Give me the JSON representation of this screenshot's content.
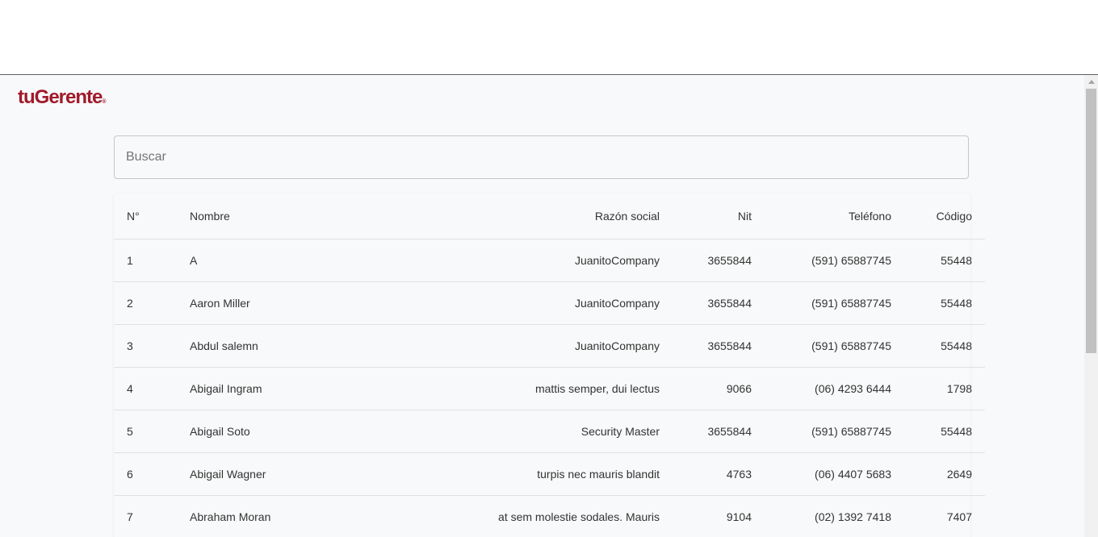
{
  "brand": {
    "name": "tuGerente",
    "mark": "®",
    "color": "#a11a2a"
  },
  "search": {
    "placeholder": "Buscar",
    "value": ""
  },
  "table": {
    "headers": {
      "num": "N°",
      "nombre": "Nombre",
      "razon": "Razón social",
      "nit": "Nit",
      "telefono": "Teléfono",
      "codigo": "Código"
    },
    "rows": [
      {
        "num": "1",
        "nombre": "A",
        "razon": "JuanitoCompany",
        "nit": "3655844",
        "telefono": "(591) 65887745",
        "codigo": "55448"
      },
      {
        "num": "2",
        "nombre": "Aaron Miller",
        "razon": "JuanitoCompany",
        "nit": "3655844",
        "telefono": "(591) 65887745",
        "codigo": "55448"
      },
      {
        "num": "3",
        "nombre": "Abdul salemn",
        "razon": "JuanitoCompany",
        "nit": "3655844",
        "telefono": "(591) 65887745",
        "codigo": "55448"
      },
      {
        "num": "4",
        "nombre": "Abigail Ingram",
        "razon": "mattis semper, dui lectus",
        "nit": "9066",
        "telefono": "(06) 4293 6444",
        "codigo": "1798"
      },
      {
        "num": "5",
        "nombre": "Abigail Soto",
        "razon": "Security Master",
        "nit": "3655844",
        "telefono": "(591) 65887745",
        "codigo": "55448"
      },
      {
        "num": "6",
        "nombre": "Abigail Wagner",
        "razon": "turpis nec mauris blandit",
        "nit": "4763",
        "telefono": "(06) 4407 5683",
        "codigo": "2649"
      },
      {
        "num": "7",
        "nombre": "Abraham Moran",
        "razon": "at sem molestie sodales. Mauris",
        "nit": "9104",
        "telefono": "(02) 1392 7418",
        "codigo": "7407"
      }
    ]
  }
}
